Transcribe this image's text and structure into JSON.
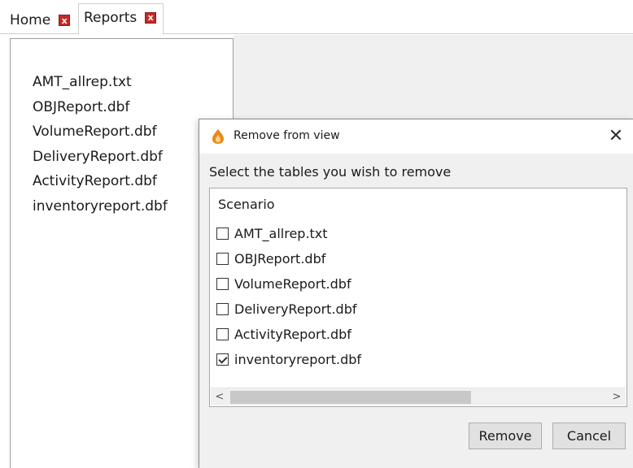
{
  "tabs": [
    {
      "label": "Home",
      "close_glyph": "x"
    },
    {
      "label": "Reports",
      "close_glyph": "x"
    }
  ],
  "file_list": [
    "AMT_allrep.txt",
    "OBJReport.dbf",
    "VolumeReport.dbf",
    "DeliveryReport.dbf",
    "ActivityReport.dbf",
    "inventoryreport.dbf"
  ],
  "dialog": {
    "title": "Remove from view",
    "close_label": "✕",
    "app_icon": "flame-app-icon",
    "prompt": "Select the tables you wish to remove",
    "list_header": "Scenario",
    "items": [
      {
        "label": "AMT_allrep.txt",
        "checked": false
      },
      {
        "label": "OBJReport.dbf",
        "checked": false
      },
      {
        "label": "VolumeReport.dbf",
        "checked": false
      },
      {
        "label": "DeliveryReport.dbf",
        "checked": false
      },
      {
        "label": "ActivityReport.dbf",
        "checked": false
      },
      {
        "label": "inventoryreport.dbf",
        "checked": true
      }
    ],
    "scroll_left": "<",
    "scroll_right": ">",
    "remove_label": "Remove",
    "cancel_label": "Cancel"
  },
  "colors": {
    "tab_close_red": "#c62828",
    "dialog_bg": "#f0f0f0",
    "icon_orange": "#e8891c"
  }
}
